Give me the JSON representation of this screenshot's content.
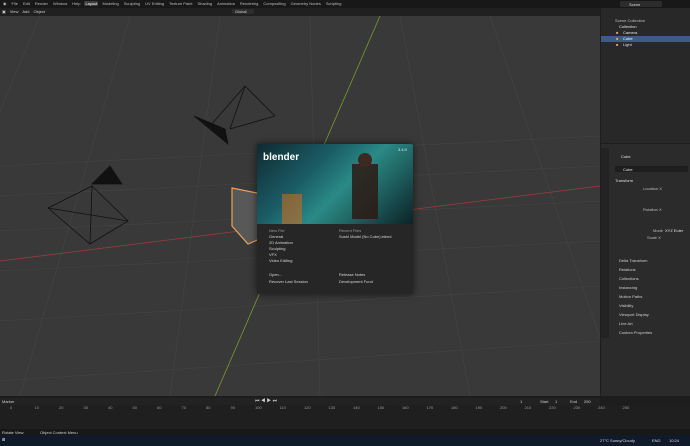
{
  "app": {
    "menu": [
      "File",
      "Edit",
      "Render",
      "Window",
      "Help"
    ],
    "workspaces": [
      "Layout",
      "Modeling",
      "Sculpting",
      "UV Editing",
      "Texture Paint",
      "Shading",
      "Animation",
      "Rendering",
      "Compositing",
      "Geometry Nodes",
      "Scripting"
    ],
    "active_workspace": "Layout",
    "scene": "Scene"
  },
  "viewport_header": {
    "items": [
      "View",
      "Add",
      "Object"
    ],
    "orientation": "Global",
    "options": "Options"
  },
  "outliner": {
    "title": "Scene Collection",
    "collection": "Collection",
    "items": [
      "Camera",
      "Cube",
      "Light"
    ]
  },
  "properties": {
    "object": "Cube",
    "object_name_field": "Cube",
    "transform_label": "Transform",
    "location": "Location X",
    "rotation": "Rotation X",
    "mode_label": "Mode",
    "mode_value": "XYZ Euler",
    "scale": "Scale X",
    "sections": [
      "Delta Transform",
      "Relations",
      "Collections",
      "Instancing",
      "Motion Paths",
      "Visibility",
      "Viewport Display",
      "Line Art",
      "Custom Properties"
    ]
  },
  "splash": {
    "logo": "blender",
    "version": "3.4.0",
    "new_file_title": "New File",
    "new_files": [
      "General",
      "2D Animation",
      "Sculpting",
      "VFX",
      "Video Editing"
    ],
    "recent_title": "Recent Files",
    "recent_files": [
      "Sushi Model (No Cube).blend"
    ],
    "open": "Open...",
    "recover": "Recover Last Session",
    "release_notes": "Release Notes",
    "dev_fund": "Development Fund"
  },
  "timeline": {
    "header_items": [
      "Playback",
      "Keying",
      "View",
      "Marker"
    ],
    "current_frame": "1",
    "start_label": "Start",
    "start": "1",
    "end_label": "End",
    "end": "250",
    "ticks": [
      "0",
      "10",
      "20",
      "30",
      "40",
      "50",
      "60",
      "70",
      "80",
      "90",
      "100",
      "110",
      "120",
      "130",
      "140",
      "150",
      "160",
      "170",
      "180",
      "190",
      "200",
      "210",
      "220",
      "230",
      "240",
      "250"
    ]
  },
  "status": {
    "left": "Rotate View",
    "center": "Object Context Menu"
  },
  "taskbar": {
    "weather": "27°C Sunny/Cloudy",
    "time": "10:24",
    "lang": "ENG"
  },
  "colors": {
    "accent": "#4772b3",
    "cube_orange": "#e8a25c",
    "x_axis": "#9c3d3d",
    "y_axis": "#7a9a2d"
  }
}
